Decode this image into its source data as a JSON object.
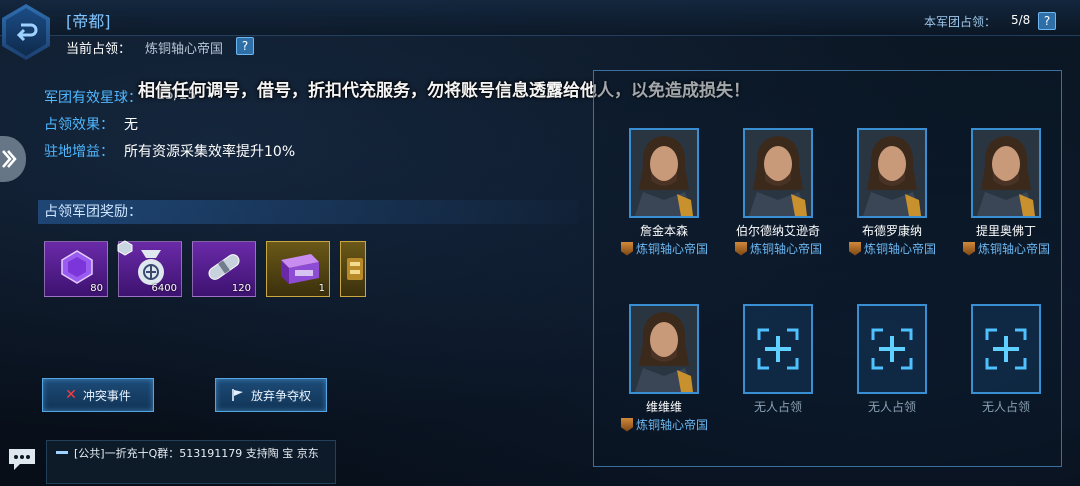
{
  "header": {
    "title": "[帝都]",
    "occupied_label": "当前占领：",
    "occupied_value": "炼铜轴心帝国",
    "corps_label": "本军团占领：",
    "corps_value": "5/8",
    "help_symbol": "?"
  },
  "notice": "相信任何调号，借号，折扣代充服务，勿将账号信息透露给他人，以免造成损失！",
  "info": {
    "planets_label": "军团有效星球：",
    "planets_value": "15/15",
    "effect_label": "占领效果：",
    "effect_value": "无",
    "bonus_label": "驻地增益：",
    "bonus_value": "所有资源采集效率提升10%"
  },
  "rewards": {
    "header": "占领军团奖励：",
    "items": [
      {
        "icon": "crystal-icon",
        "count": "80"
      },
      {
        "icon": "money-bag-icon",
        "count": "6400"
      },
      {
        "icon": "capsule-icon",
        "count": "120"
      },
      {
        "icon": "supply-crate-icon",
        "count": "1"
      },
      {
        "icon": "gold-item-icon",
        "count": ""
      }
    ]
  },
  "buttons": {
    "conflict": "冲突事件",
    "abandon": "放弃争夺权"
  },
  "chat": {
    "text": "[公共]一折充十Q群：513191179   支持陶 宝 京东"
  },
  "members": [
    {
      "name": "詹金本森",
      "guild": "炼铜轴心帝国"
    },
    {
      "name": "伯尔德纳艾逊奇",
      "guild": "炼铜轴心帝国"
    },
    {
      "name": "布德罗康纳",
      "guild": "炼铜轴心帝国"
    },
    {
      "name": "提里奥佛丁",
      "guild": "炼铜轴心帝国"
    },
    {
      "name": "维维维",
      "guild": "炼铜轴心帝国"
    }
  ],
  "empty_slots": [
    {
      "label": "无人占领"
    },
    {
      "label": "无人占领"
    },
    {
      "label": "无人占领"
    }
  ],
  "colors": {
    "accent": "#4fb7ff",
    "panel_border": "#3a8fd3",
    "reward_purple": "#6a2aa8",
    "reward_gold": "#c9a840"
  }
}
